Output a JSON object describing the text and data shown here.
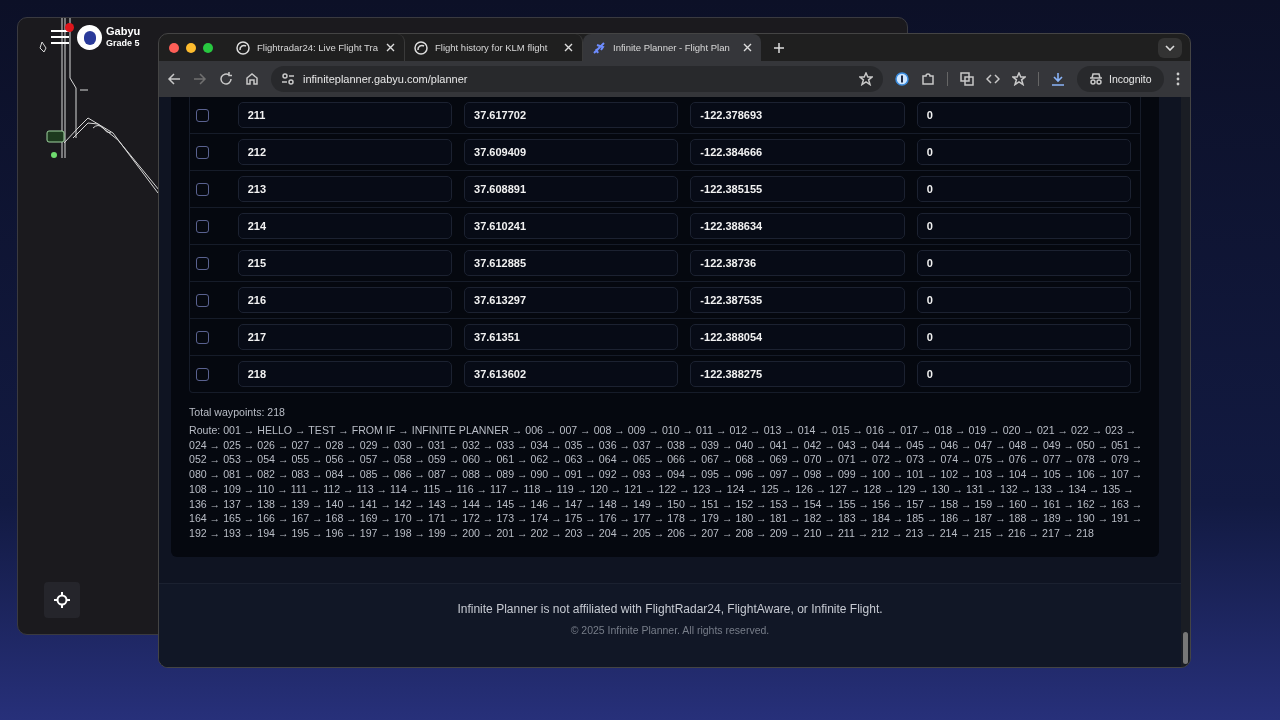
{
  "map_window": {
    "user_name": "Gabyu",
    "user_grade": "Grade 5",
    "notification_dot": true
  },
  "browser": {
    "tabs": [
      {
        "kind": "site",
        "title": "Flightradar24: Live Flight Tra",
        "selected": false
      },
      {
        "kind": "site",
        "title": "Flight history for KLM flight",
        "selected": false
      },
      {
        "kind": "plane",
        "title": "Infinite Planner - Flight Plan",
        "selected": true
      }
    ],
    "url": "infiniteplanner.gabyu.com/planner",
    "profile": "Incognito"
  },
  "waypoints": {
    "rows": [
      {
        "checked": false,
        "name": "211",
        "lat": "37.617702",
        "lon": "-122.378693",
        "alt": "0"
      },
      {
        "checked": false,
        "name": "212",
        "lat": "37.609409",
        "lon": "-122.384666",
        "alt": "0"
      },
      {
        "checked": false,
        "name": "213",
        "lat": "37.608891",
        "lon": "-122.385155",
        "alt": "0"
      },
      {
        "checked": false,
        "name": "214",
        "lat": "37.610241",
        "lon": "-122.388634",
        "alt": "0"
      },
      {
        "checked": false,
        "name": "215",
        "lat": "37.612885",
        "lon": "-122.38736",
        "alt": "0"
      },
      {
        "checked": false,
        "name": "216",
        "lat": "37.613297",
        "lon": "-122.387535",
        "alt": "0"
      },
      {
        "checked": false,
        "name": "217",
        "lat": "37.61351",
        "lon": "-122.388054",
        "alt": "0"
      },
      {
        "checked": false,
        "name": "218",
        "lat": "37.613602",
        "lon": "-122.388275",
        "alt": "0"
      }
    ]
  },
  "summary": {
    "total": "Total waypoints: 218",
    "route": "Route: 001 → HELLO → TEST → FROM IF → INFINITE PLANNER → 006 → 007 → 008 → 009 → 010 → 011 → 012 → 013 → 014 → 015 → 016 → 017 → 018 → 019 → 020 → 021 → 022 → 023 → 024 → 025 → 026 → 027 → 028 → 029 → 030 → 031 → 032 → 033 → 034 → 035 → 036 → 037 → 038 → 039 → 040 → 041 → 042 → 043 → 044 → 045 → 046 → 047 → 048 → 049 → 050 → 051 → 052 → 053 → 054 → 055 → 056 → 057 → 058 → 059 → 060 → 061 → 062 → 063 → 064 → 065 → 066 → 067 → 068 → 069 → 070 → 071 → 072 → 073 → 074 → 075 → 076 → 077 → 078 → 079 → 080 → 081 → 082 → 083 → 084 → 085 → 086 → 087 → 088 → 089 → 090 → 091 → 092 → 093 → 094 → 095 → 096 → 097 → 098 → 099 → 100 → 101 → 102 → 103 → 104 → 105 → 106 → 107 → 108 → 109 → 110 → 111 → 112 → 113 → 114 → 115 → 116 → 117 → 118 → 119 → 120 → 121 → 122 → 123 → 124 → 125 → 126 → 127 → 128 → 129 → 130 → 131 → 132 → 133 → 134 → 135 → 136 → 137 → 138 → 139 → 140 → 141 → 142 → 143 → 144 → 145 → 146 → 147 → 148 → 149 → 150 → 151 → 152 → 153 → 154 → 155 → 156 → 157 → 158 → 159 → 160 → 161 → 162 → 163 → 164 → 165 → 166 → 167 → 168 → 169 → 170 → 171 → 172 → 173 → 174 → 175 → 176 → 177 → 178 → 179 → 180 → 181 → 182 → 183 → 184 → 185 → 186 → 187 → 188 → 189 → 190 → 191 → 192 → 193 → 194 → 195 → 196 → 197 → 198 → 199 → 200 → 201 → 202 → 203 → 204 → 205 → 206 → 207 → 208 → 209 → 210 → 211 → 212 → 213 → 214 → 215 → 216 → 217 → 218"
  },
  "footer": {
    "disclaimer": "Infinite Planner is not affiliated with FlightRadar24, FlightAware, or Infinite Flight.",
    "copyright": "© 2025 Infinite Planner. All rights reserved."
  }
}
